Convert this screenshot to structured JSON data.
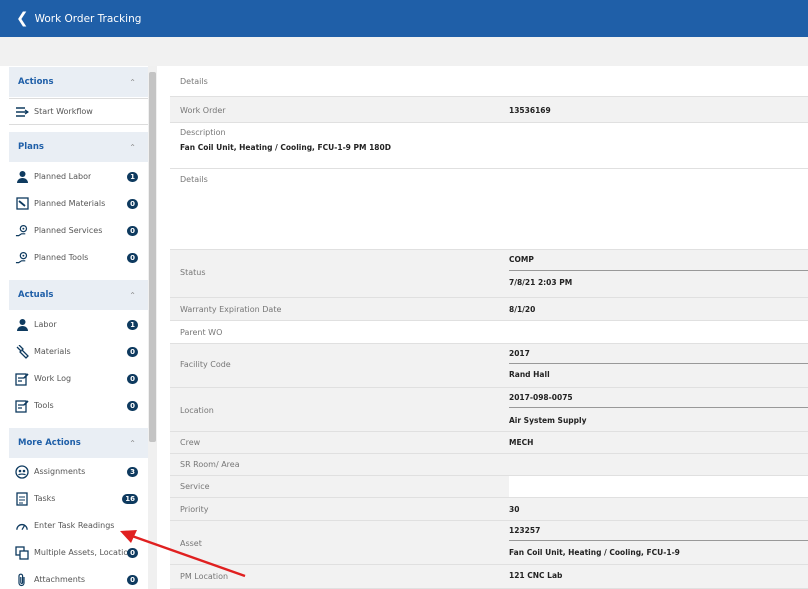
{
  "header": {
    "back_icon": "chevron-left-icon",
    "title": "Work Order Tracking"
  },
  "colors": {
    "topbar": "#1f5fa8",
    "accent": "#1f5fa8",
    "badge": "#0e3a5f",
    "arrow": "#e02020"
  },
  "sidebar": {
    "actions": {
      "title": "Actions",
      "items": [
        {
          "label": "Start Workflow",
          "icon": "workflow-icon"
        }
      ]
    },
    "plans": {
      "title": "Plans",
      "items": [
        {
          "label": "Planned Labor",
          "icon": "labor-icon",
          "count": "1"
        },
        {
          "label": "Planned Materials",
          "icon": "materials-icon",
          "count": "0"
        },
        {
          "label": "Planned Services",
          "icon": "services-icon",
          "count": "0"
        },
        {
          "label": "Planned Tools",
          "icon": "tools-icon",
          "count": "0"
        }
      ]
    },
    "actuals": {
      "title": "Actuals",
      "items": [
        {
          "label": "Labor",
          "icon": "labor-icon",
          "count": "1"
        },
        {
          "label": "Materials",
          "icon": "wrench-icon",
          "count": "0"
        },
        {
          "label": "Work Log",
          "icon": "worklog-icon",
          "count": "0"
        },
        {
          "label": "Tools",
          "icon": "tools-doc-icon",
          "count": "0"
        }
      ]
    },
    "more": {
      "title": "More Actions",
      "items": [
        {
          "label": "Assignments",
          "icon": "assignments-icon",
          "count": "3"
        },
        {
          "label": "Tasks",
          "icon": "tasks-icon",
          "count": "16"
        },
        {
          "label": "Enter Task Readings",
          "icon": "readings-icon"
        },
        {
          "label": "Multiple Assets, Locations",
          "icon": "multiple-assets-icon",
          "count": "0"
        },
        {
          "label": "Attachments",
          "icon": "paperclip-icon",
          "count": "0"
        }
      ]
    }
  },
  "details": {
    "section_label": "Details",
    "work_order": {
      "label": "Work Order",
      "value": "13536169"
    },
    "description": {
      "label": "Description",
      "value": "Fan Coil Unit, Heating / Cooling, FCU-1-9 PM 180D"
    },
    "long_details": {
      "label": "Details"
    },
    "status": {
      "label": "Status",
      "value": "COMP",
      "date": "7/8/21 2:03 PM"
    },
    "warranty": {
      "label": "Warranty Expiration Date",
      "value": "8/1/20"
    },
    "parent_wo": {
      "label": "Parent WO"
    },
    "facility": {
      "label": "Facility Code",
      "value": "2017",
      "desc": "Rand Hall"
    },
    "location": {
      "label": "Location",
      "value": "2017-098-0075",
      "desc": "Air System Supply"
    },
    "crew": {
      "label": "Crew",
      "value": "MECH"
    },
    "sr_room": {
      "label": "SR Room/ Area"
    },
    "service": {
      "label": "Service"
    },
    "priority": {
      "label": "Priority",
      "value": "30"
    },
    "asset": {
      "label": "Asset",
      "value": "123257",
      "desc": "Fan Coil Unit, Heating / Cooling, FCU-1-9"
    },
    "pm_location": {
      "label": "PM Location",
      "value": "121 CNC Lab"
    }
  }
}
